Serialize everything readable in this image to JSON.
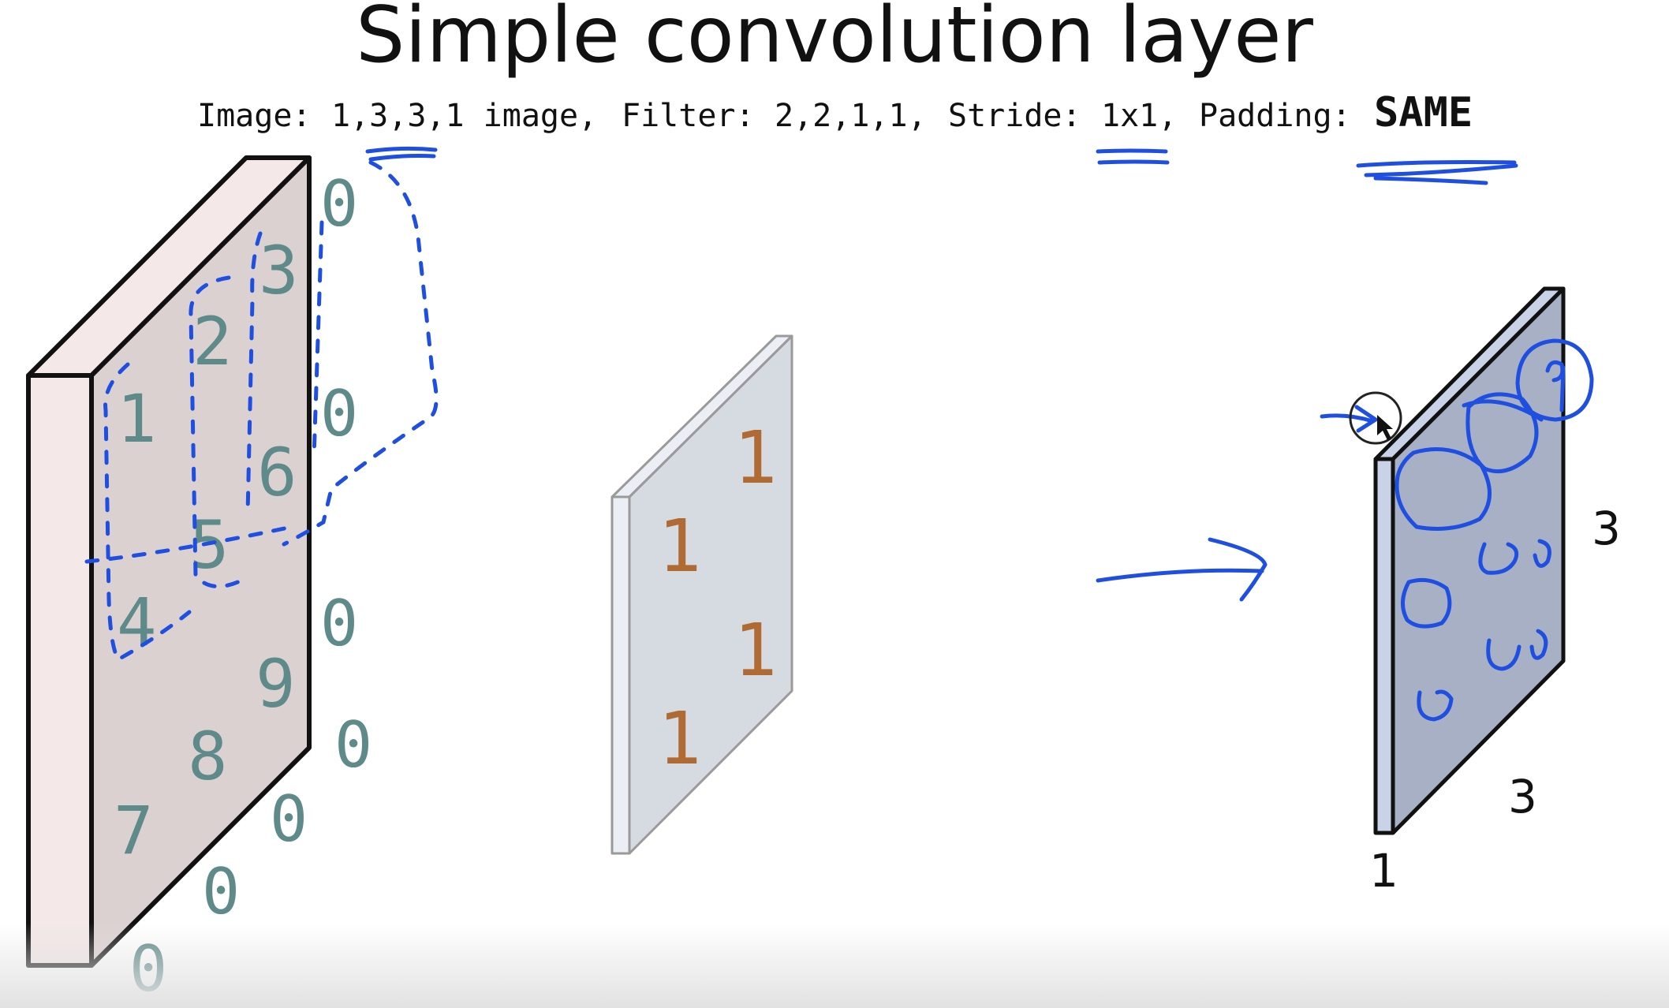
{
  "title": "Simple convolution layer",
  "subtitle": {
    "image_label": "Image:",
    "image_value": "1,3,3,1 image,",
    "filter_label": "Filter:",
    "filter_value": "2,2,1,1,",
    "stride_label": "Stride:",
    "stride_value": "1x1,",
    "padding_label": "Padding:",
    "padding_value": "SAME"
  },
  "input_image": {
    "values": [
      "1",
      "2",
      "3",
      "4",
      "5",
      "6",
      "7",
      "8",
      "9"
    ],
    "padding_zeros": [
      "0",
      "0",
      "0",
      "0",
      "0",
      "0",
      "0"
    ]
  },
  "filter": {
    "values": [
      "1",
      "1",
      "1",
      "1"
    ]
  },
  "output": {
    "width_label": "3",
    "height_label": "3",
    "depth_label": "1"
  },
  "colors": {
    "input_face": "#dcd1d1",
    "input_side": "#f4e8e8",
    "filter_face": "#d6dbe2",
    "output_face": "#a8b0c6",
    "output_side": "#c9d2e6",
    "annotation_ink": "#1f4fe0",
    "input_digits": "#5f8a8a",
    "filter_digits": "#b06a34"
  }
}
